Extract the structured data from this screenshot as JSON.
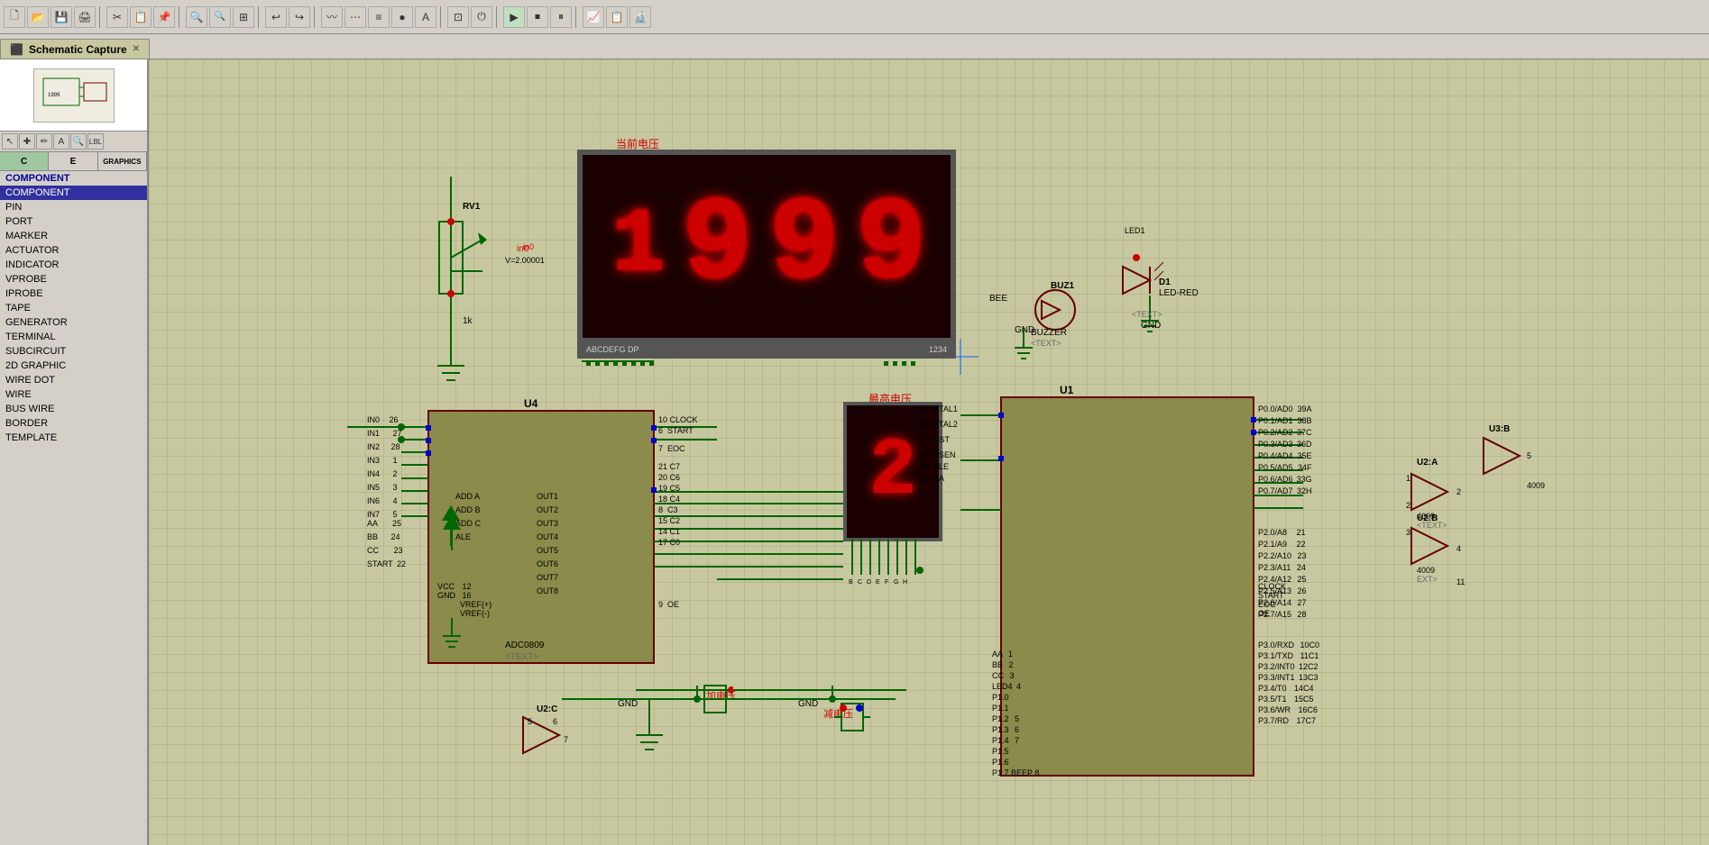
{
  "app": {
    "title": "Schematic Capture",
    "tab_label": "Schematic Capture"
  },
  "toolbar": {
    "buttons": [
      "📁",
      "💾",
      "🖨",
      "⚡",
      "📋",
      "🔍",
      "➕",
      "❌",
      "↩",
      "↪",
      "✂",
      "📋",
      "📌",
      "🔀",
      "⚙",
      "🔧"
    ]
  },
  "left_panel": {
    "cat_tabs": [
      "C",
      "E",
      "GRAPHICS"
    ],
    "active_cat": "C",
    "component_label": "COMPONENT",
    "items": [
      {
        "label": "PIN",
        "selected": false
      },
      {
        "label": "PORT",
        "selected": false
      },
      {
        "label": "MARKER",
        "selected": false
      },
      {
        "label": "ACTUATOR",
        "selected": false
      },
      {
        "label": "INDICATOR",
        "selected": false
      },
      {
        "label": "VPROBE",
        "selected": false
      },
      {
        "label": "IPROBE",
        "selected": false
      },
      {
        "label": "TAPE",
        "selected": false
      },
      {
        "label": "GENERATOR",
        "selected": false
      },
      {
        "label": "TERMINAL",
        "selected": false
      },
      {
        "label": "SUBCIRCUIT",
        "selected": false
      },
      {
        "label": "2D GRAPHIC",
        "selected": false
      },
      {
        "label": "WIRE DOT",
        "selected": false
      },
      {
        "label": "WIRE",
        "selected": false
      },
      {
        "label": "BUS WIRE",
        "selected": false
      },
      {
        "label": "BORDER",
        "selected": false
      },
      {
        "label": "TEMPLATE",
        "selected": false
      }
    ],
    "selected_item": "COMPONENT"
  },
  "schematic": {
    "voltage_label": "当前电压",
    "max_voltage_label": "最高电压",
    "add_voltage_label": "加电压",
    "reduce_voltage_label": "减电压",
    "display_value": "1999",
    "small_display_value": "2",
    "rv1_label": "RV1",
    "rv1_value": "V=2.00001",
    "rv1_in0": "in0",
    "rv1_resistance": "1k",
    "u4_label": "U4",
    "u4_chip": "ADC0809",
    "u1_label": "U1",
    "u1_chip": "",
    "u2a_label": "U2:A",
    "u2b_label": "U2:B",
    "u2c_label": "U2:C",
    "u3b_label": "U3:B",
    "buz1_label": "BUZ1",
    "buz_text": "BUZZER",
    "d1_label": "D1",
    "d1_text": "LED-RED",
    "led1_label": "LED1",
    "seg_bottom_text": "ABCDEFG DP",
    "seg_bottom_num": "1234",
    "chip_4009_1": "4009",
    "chip_4009_2": "4009",
    "chip_4009_3": "4009"
  }
}
